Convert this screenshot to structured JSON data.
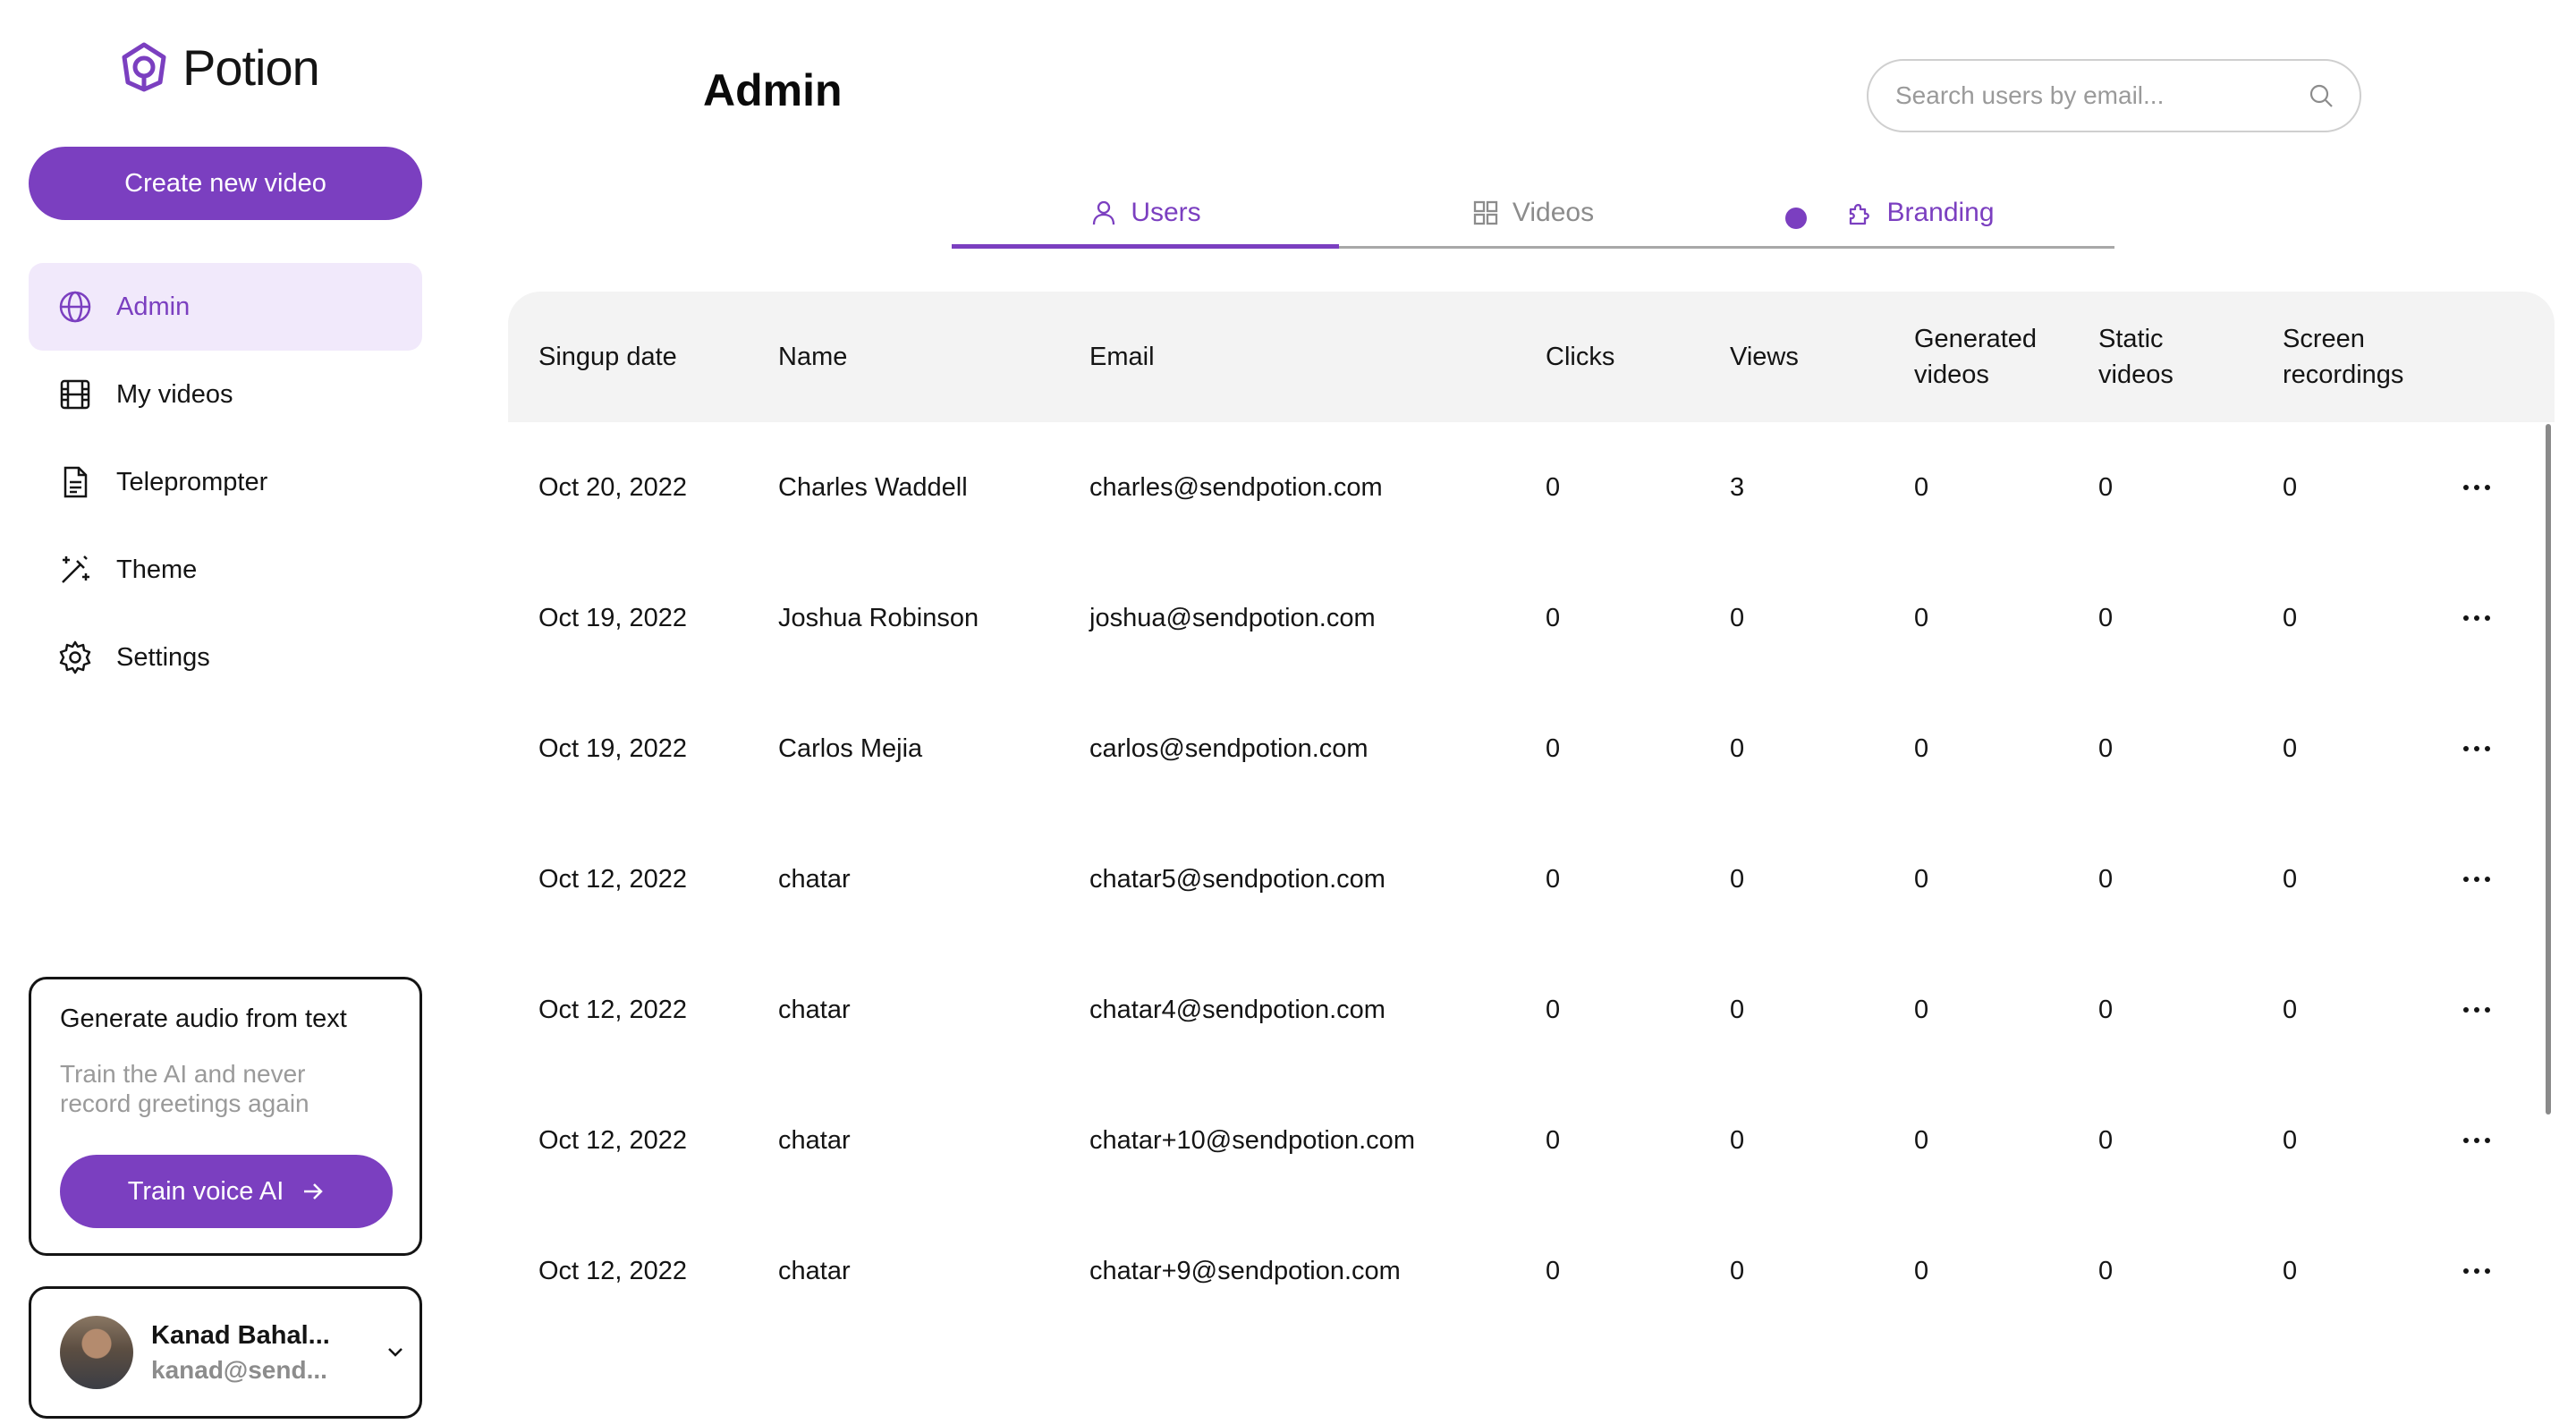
{
  "app": {
    "name": "Potion",
    "accent": "#7b3fc0"
  },
  "sidebar": {
    "create_button": "Create new video",
    "items": [
      {
        "label": "Admin",
        "icon": "globe-icon",
        "active": true
      },
      {
        "label": "My videos",
        "icon": "film-icon"
      },
      {
        "label": "Teleprompter",
        "icon": "document-icon"
      },
      {
        "label": "Theme",
        "icon": "magic-wand-icon"
      },
      {
        "label": "Settings",
        "icon": "gear-icon"
      }
    ],
    "promo": {
      "title": "Generate audio from text",
      "text": "Train the AI and never record greetings again",
      "button": "Train voice AI"
    },
    "user": {
      "name": "Kanad Bahal...",
      "email": "kanad@send..."
    }
  },
  "header": {
    "title": "Admin",
    "search": {
      "placeholder": "Search users by email...",
      "value": ""
    }
  },
  "tabs": [
    {
      "label": "Users",
      "icon": "user-icon",
      "active": true
    },
    {
      "label": "Videos",
      "icon": "grid-icon"
    },
    {
      "label": "Branding",
      "icon": "puzzle-icon"
    }
  ],
  "table": {
    "columns": [
      "Singup date",
      "Name",
      "Email",
      "Clicks",
      "Views",
      "Generated videos",
      "Static videos",
      "Screen recordings"
    ],
    "rows": [
      [
        "Oct 20, 2022",
        "Charles Waddell",
        "charles@sendpotion.com",
        "0",
        "3",
        "0",
        "0",
        "0"
      ],
      [
        "Oct 19, 2022",
        "Joshua Robinson",
        "joshua@sendpotion.com",
        "0",
        "0",
        "0",
        "0",
        "0"
      ],
      [
        "Oct 19, 2022",
        "Carlos Mejia",
        "carlos@sendpotion.com",
        "0",
        "0",
        "0",
        "0",
        "0"
      ],
      [
        "Oct 12, 2022",
        "chatar",
        "chatar5@sendpotion.com",
        "0",
        "0",
        "0",
        "0",
        "0"
      ],
      [
        "Oct 12, 2022",
        "chatar",
        "chatar4@sendpotion.com",
        "0",
        "0",
        "0",
        "0",
        "0"
      ],
      [
        "Oct 12, 2022",
        "chatar",
        "chatar+10@sendpotion.com",
        "0",
        "0",
        "0",
        "0",
        "0"
      ],
      [
        "Oct 12, 2022",
        "chatar",
        "chatar+9@sendpotion.com",
        "0",
        "0",
        "0",
        "0",
        "0"
      ]
    ]
  }
}
